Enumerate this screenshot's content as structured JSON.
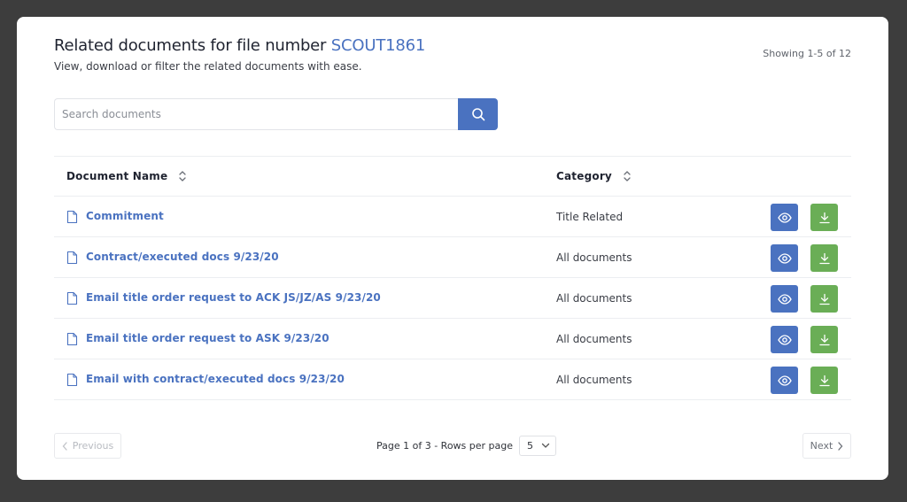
{
  "header": {
    "title_prefix": "Related documents for file number ",
    "file_number": "SCOUT1861",
    "subtitle": "View, download or filter the related documents with ease.",
    "showing": "Showing 1-5 of 12"
  },
  "search": {
    "placeholder": "Search documents",
    "value": "",
    "icon": "search-icon"
  },
  "table": {
    "columns": [
      "Document Name",
      "Category"
    ],
    "rows": [
      {
        "name": "Commitment",
        "category": "Title Related"
      },
      {
        "name": "Contract/executed docs 9/23/20",
        "category": "All documents"
      },
      {
        "name": "Email title order request to ACK JS/JZ/AS 9/23/20",
        "category": "All documents"
      },
      {
        "name": "Email title order request to ASK 9/23/20",
        "category": "All documents"
      },
      {
        "name": "Email with contract/executed docs 9/23/20",
        "category": "All documents"
      }
    ],
    "row_icons": [
      "document-icon",
      "eye-icon",
      "download-icon"
    ]
  },
  "pagination": {
    "previous_label": "Previous",
    "next_label": "Next",
    "info": "Page 1 of 3 - Rows per page",
    "rows_per_page": "5"
  },
  "colors": {
    "accent": "#4a72c0",
    "download": "#6aae56",
    "backdrop": "#3d3d3d"
  }
}
